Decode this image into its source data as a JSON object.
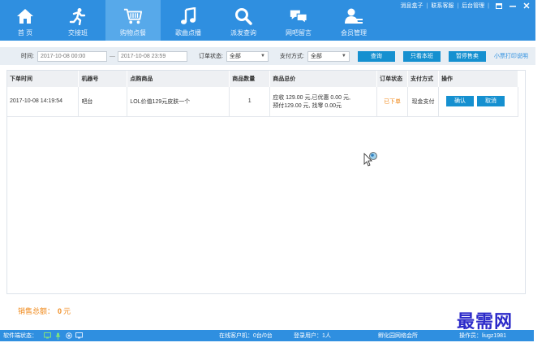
{
  "nav": {
    "items": [
      {
        "label": "首  页",
        "icon": "home-icon"
      },
      {
        "label": "交接班",
        "icon": "runner-icon"
      },
      {
        "label": "购物点餐",
        "icon": "shopping-cart-icon",
        "active": true
      },
      {
        "label": "歌曲点播",
        "icon": "music-note-icon"
      },
      {
        "label": "派发查询",
        "icon": "search-icon"
      },
      {
        "label": "网吧留言",
        "icon": "chat-bubbles-icon"
      },
      {
        "label": "会员管理",
        "icon": "member-icon"
      }
    ]
  },
  "toplinks": {
    "msg_box": "消息盒子",
    "contact": "联系客服",
    "backend": "后台管理"
  },
  "filters": {
    "time_label": "时间:",
    "date_from": "2017-10-08 00:00",
    "date_sep": "—",
    "date_to": "2017-10-08 23:59",
    "order_status_label": "订单状态:",
    "order_status_value": "全部",
    "payment_label": "支付方式:",
    "payment_value": "全部",
    "query_button": "查询",
    "current_shift_button": "只看本班",
    "pause_takeout_button": "暂停售卖",
    "print_link": "小票打印说明"
  },
  "table": {
    "headers": [
      "下单时间",
      "机器号",
      "点购商品",
      "商品数量",
      "商品总价",
      "订单状态",
      "支付方式",
      "操作"
    ],
    "rows": [
      {
        "time": "2017-10-08 14:19:54",
        "machine": "吧台",
        "product": "LOL价值129元皮肤一个",
        "quantity": "1",
        "price_line1": "应收 129.00 元,已优惠 0.00 元,",
        "price_line2": "预付129.00 元, 找零 0.00元",
        "status": "已下单",
        "payment": "现金支付",
        "confirm": "确认",
        "cancel": "取消"
      }
    ]
  },
  "footer": {
    "sales_total_label": "销售总额：",
    "sales_total_value": "0",
    "sales_total_unit": "元"
  },
  "statusbar": {
    "software_status": "软件端状态：",
    "online_clients": "在线客户机：0台/0台",
    "logged_users": "登录用户：1人",
    "cafe_name": "孵化园网络会所",
    "operator": "操作员：liugz1981"
  },
  "watermark": "最需网",
  "colors": {
    "primary": "#2f8fe0",
    "button": "#1590d0",
    "accent_orange": "#f08a1c",
    "watermark": "#2c2ac9"
  }
}
